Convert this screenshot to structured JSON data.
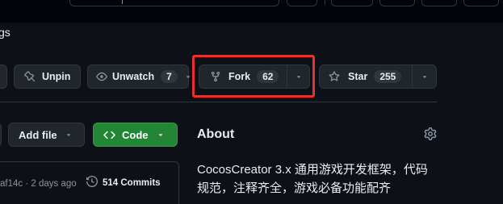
{
  "subnav": {
    "partial_tab_label": "gs"
  },
  "repo_actions": {
    "unpin_label": "Unpin",
    "watch_label": "Unwatch",
    "watch_count": "7",
    "fork_label": "Fork",
    "fork_count": "62",
    "star_label": "Star",
    "star_count": "255"
  },
  "file_actions": {
    "add_file_label": "Add file",
    "code_label": "Code"
  },
  "latest_commit": {
    "meta": "af14c · 2 days ago",
    "commits_label": "514 Commits"
  },
  "about": {
    "title": "About",
    "description": "CocosCreator 3.x 通用游戏开发框架，代码规范，注释齐全，游戏必备功能配齐"
  },
  "colors": {
    "background": "#0d1117",
    "button_bg": "#21262d",
    "border": "#30363d",
    "code_button": "#238636",
    "highlight": "#e5322d"
  },
  "icons": [
    "pin-icon",
    "eye-icon",
    "repo-forked-icon",
    "star-icon",
    "triangle-down-icon",
    "code-icon",
    "gear-icon",
    "history-icon"
  ]
}
